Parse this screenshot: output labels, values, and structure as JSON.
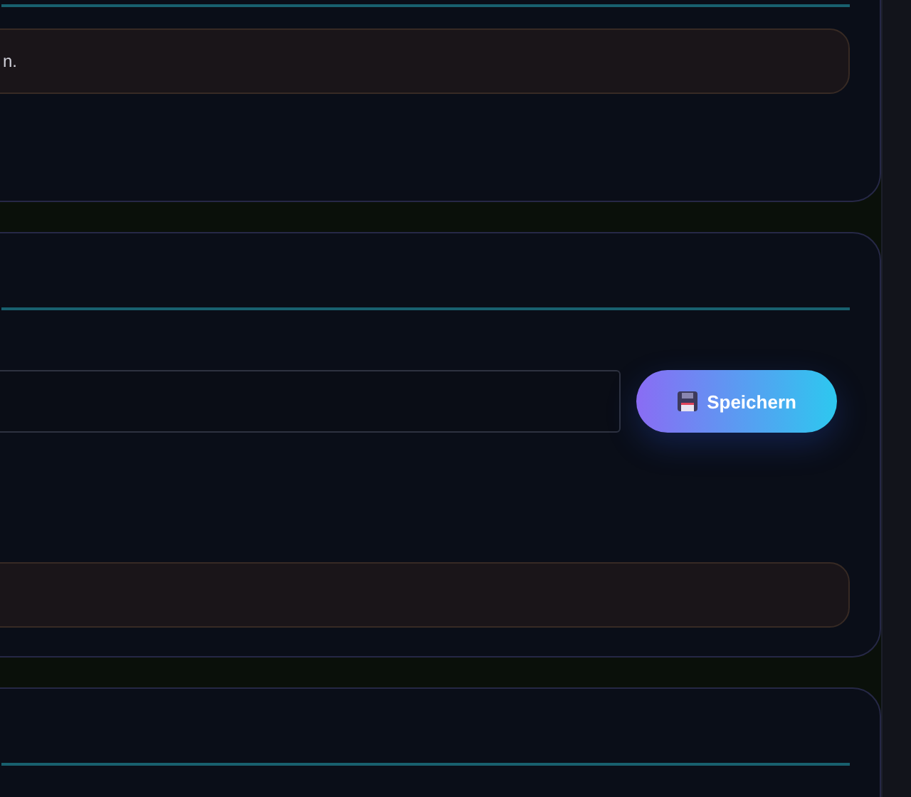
{
  "cards": [
    {
      "kind": "notice",
      "notice_text": "n."
    },
    {
      "kind": "form",
      "button_label": "Speichern"
    },
    {
      "kind": "header"
    }
  ]
}
